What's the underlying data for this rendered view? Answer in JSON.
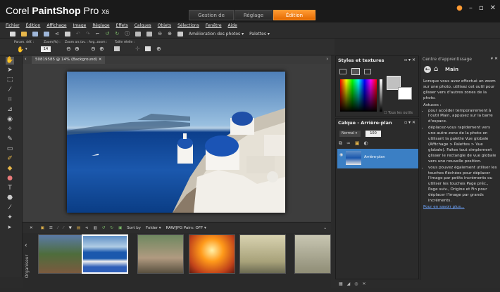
{
  "app": {
    "title_prefix": "Corel ",
    "title_brand": "PaintShop",
    "title_suffix": " Pro",
    "title_version": "X6"
  },
  "workspace_tabs": [
    "Gestion de photos",
    "Réglage",
    "Édition"
  ],
  "menu": [
    "Fichier",
    "Édition",
    "Affichage",
    "Image",
    "Réglage",
    "Effets",
    "Calques",
    "Objets",
    "Sélections",
    "Fenêtre",
    "Aide"
  ],
  "toolbar": {
    "enhance": "Amélioration des photos",
    "palettes": "Palettes"
  },
  "options": {
    "presets": "Param. déf. :",
    "zoom_pct_label": "Zoom(%) :",
    "zoom_value": "14",
    "zoom_ops": "Zoom arr./av. :",
    "zoom_fit": "Avg. zoom :",
    "real_size": "Taille réelle :"
  },
  "document": {
    "tab": "50819585 @ 14% (Background)"
  },
  "organizer": {
    "sort_by": "Sort by",
    "sort_value": "Folder",
    "filter": "RAW/JPG Pairs: OFF",
    "label": "Organiseur"
  },
  "styles": {
    "title": "Styles et textures",
    "all_tools": "Tous les outils"
  },
  "layers": {
    "title": "Calque - Arrière-plan",
    "blend": "Normal",
    "opacity": "100",
    "layer_name": "Arrière-plan"
  },
  "learn": {
    "title": "Centre d'apprentissage",
    "heading": "Main",
    "intro": "Lorsque vous avez effectué un zoom sur une photo, utilisez cet outil pour glisser vers d'autres zones de la photo.",
    "tips_label": "Astuces :",
    "tips": [
      "pour accéder temporairement à l'outil Main, appuyez sur la barre d'espace.",
      "déplacez-vous rapidement vers une autre zone de la photo en utilisant la palette Vue globale (Affichage > Palettes > Vue globale). Faites tout simplement glisser le rectangle de vue globale vers une nouvelle position.",
      "vous pouvez également utiliser les touches fléchées pour déplacer l'image par petits incréments ou utiliser les touches Page préc., Page suiv., Origine et Fin pour déplacer l'image par grands incréments."
    ],
    "more": "Pour en savoir plus..."
  },
  "colors": {
    "accent": "#ff8c1a",
    "panel": "#2b2b2b",
    "selected_layer": "#3b7fc4"
  }
}
